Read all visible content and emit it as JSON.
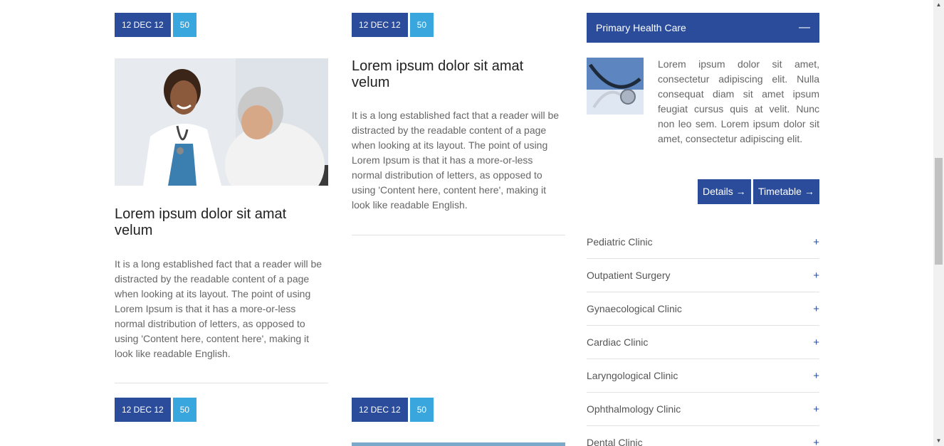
{
  "posts": [
    {
      "date": "12 DEC 12",
      "count": "50",
      "title": "Lorem ipsum dolor sit amat velum",
      "text": "It is a long established fact that a reader will be distracted by the readable content of a page when looking at its layout. The point of using Lorem Ipsum is that it has a more-or-less normal distribution of letters, as opposed to using 'Content here, content here', making it look like readable English."
    },
    {
      "date": "12 DEC 12",
      "count": "50",
      "title": "Lorem ipsum dolor sit amat velum",
      "text": "It is a long established fact that a reader will be distracted by the readable content of a page when looking at its layout. The point of using Lorem Ipsum is that it has a more-or-less normal distribution of letters, as opposed to using 'Content here, content here', making it look like readable English."
    },
    {
      "date": "12 DEC 12",
      "count": "50"
    },
    {
      "date": "12 DEC 12",
      "count": "50"
    }
  ],
  "sidebar": {
    "header": "Primary Health Care",
    "toggle": "—",
    "text": "Lorem ipsum dolor sit amet, consectetur adipiscing elit. Nulla consequat diam sit amet ipsum feugiat cursus quis at velit. Nunc non leo sem. Lorem ipsum dolor sit amet, consectetur adipiscing elit.",
    "details_label": "Details →",
    "timetable_label": "Timetable →",
    "clinics": [
      {
        "label": "Pediatric Clinic",
        "icon": "+"
      },
      {
        "label": "Outpatient Surgery",
        "icon": "+"
      },
      {
        "label": "Gynaecological Clinic",
        "icon": "+"
      },
      {
        "label": "Cardiac Clinic",
        "icon": "+"
      },
      {
        "label": "Laryngological Clinic",
        "icon": "+"
      },
      {
        "label": "Ophthalmology Clinic",
        "icon": "+"
      },
      {
        "label": "Dental Clinic",
        "icon": "+"
      }
    ]
  },
  "colors": {
    "primary": "#2b4c9b",
    "accent": "#3aa6de"
  }
}
